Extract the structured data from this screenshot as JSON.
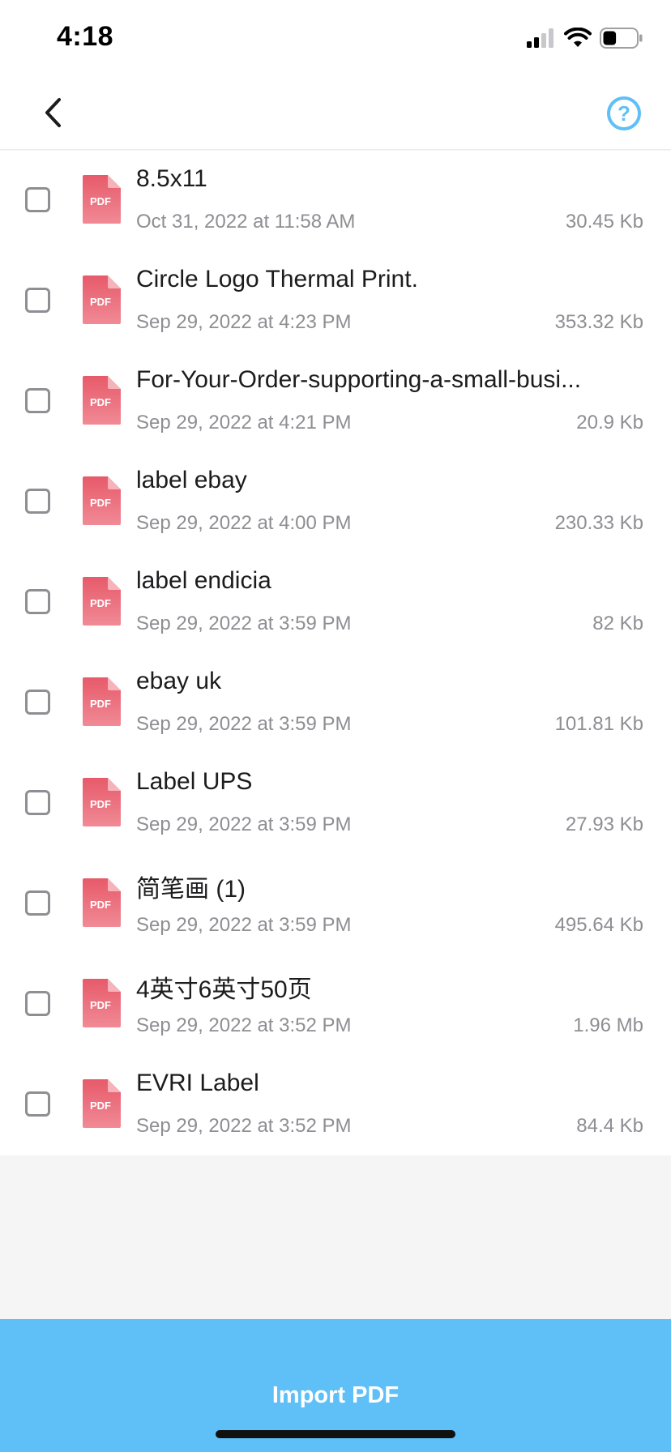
{
  "status_bar": {
    "time": "4:18",
    "battery_level": 0.4
  },
  "nav": {
    "back_icon": "chevron-left-icon",
    "help_icon": "question-circle-icon",
    "help_icon_color": "#5ec0f7",
    "help_symbol": "?"
  },
  "colors": {
    "accent": "#5ec0f7",
    "pdf_icon": "#ee6a78",
    "secondary_text": "#8e8e93"
  },
  "file_icon_label": "PDF",
  "files": [
    {
      "name": "8.5x11",
      "date": "Oct 31, 2022 at 11:58 AM",
      "size": "30.45 Kb"
    },
    {
      "name": "Circle Logo Thermal Print.",
      "date": "Sep 29, 2022 at 4:23 PM",
      "size": "353.32 Kb"
    },
    {
      "name": "For-Your-Order-supporting-a-small-busi...",
      "date": "Sep 29, 2022 at 4:21 PM",
      "size": "20.9 Kb"
    },
    {
      "name": "label ebay",
      "date": "Sep 29, 2022 at 4:00 PM",
      "size": "230.33 Kb"
    },
    {
      "name": "label endicia",
      "date": "Sep 29, 2022 at 3:59 PM",
      "size": "82 Kb"
    },
    {
      "name": "ebay uk",
      "date": "Sep 29, 2022 at 3:59 PM",
      "size": "101.81 Kb"
    },
    {
      "name": "Label UPS",
      "date": "Sep 29, 2022 at 3:59 PM",
      "size": "27.93 Kb"
    },
    {
      "name": "简笔画 (1)",
      "date": "Sep 29, 2022 at 3:59 PM",
      "size": "495.64 Kb"
    },
    {
      "name": "4英寸6英寸50页",
      "date": "Sep 29, 2022 at 3:52 PM",
      "size": "1.96 Mb"
    },
    {
      "name": "EVRI Label",
      "date": "Sep 29, 2022 at 3:52 PM",
      "size": "84.4 Kb"
    }
  ],
  "footer": {
    "import_label": "Import PDF"
  }
}
